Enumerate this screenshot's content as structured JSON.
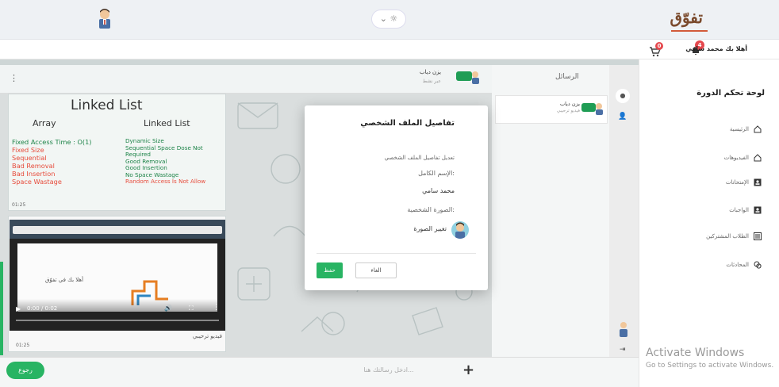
{
  "brand": {
    "name": "تفوّق"
  },
  "top": {
    "theme_toggle": "⌄ ☼"
  },
  "nav": {
    "user_name": "أهلا بك محمد سامي",
    "notifications_count": "4",
    "cart_count": "0"
  },
  "sidebar": {
    "title": "لوحة تحكم الدورة",
    "items": [
      {
        "label": "الرئيسية",
        "icon": "home-icon"
      },
      {
        "label": "الفيديوهات",
        "icon": "home-icon"
      },
      {
        "label": "الإمتحانات",
        "icon": "person-card-icon"
      },
      {
        "label": "الواجبات",
        "icon": "person-card-icon"
      },
      {
        "label": "الطلاب المشتركين",
        "icon": "list-icon"
      },
      {
        "label": "المحادثات",
        "icon": "chat-icon"
      }
    ]
  },
  "windows_watermark": {
    "line1": "Activate Windows",
    "line2": "Go to Settings to activate Windows."
  },
  "chat": {
    "header_name": "يزن دياب",
    "header_status": "عبر نشط",
    "list_title": "الرسائل",
    "list_items": [
      {
        "name": "يزن دياب",
        "preview": "فيديو ترحيبي"
      }
    ],
    "input_placeholder": "ادخل رسالتك هنا...",
    "back_label": "رجوع",
    "messages": [
      {
        "type": "slide",
        "title": "Linked List",
        "col_left": "Array",
        "col_right": "Linked List",
        "left_lines": [
          "Fixed Access Time : O(1)",
          "Fixed Size",
          "Sequential",
          "Bad Removal",
          "Bad Insertion",
          "Space Wastage"
        ],
        "right_lines": [
          "Dynamic Size",
          "Sequential Space Dose Not",
          "Required",
          "Good Removal",
          "Good Insertion",
          "No Space Wastage",
          "Random Access Is Not Allow"
        ],
        "time": "01:25"
      },
      {
        "type": "video",
        "video_caption": "أهلا بك في تفوّق",
        "player_time": "0:00 / 0:02",
        "caption": "فيديو ترحيبي",
        "time": "01:25"
      }
    ]
  },
  "modal": {
    "title": "تفاصيل الملف الشخصي",
    "edit_label": "تعديل تفاصيل الملف الشخصي",
    "fullname_label": "الإسم الكامل:",
    "fullname_value": "محمد سامي",
    "photo_label": "الصورة الشخصية:",
    "change_photo": "تغيير الصورة",
    "save_button": "حفظ",
    "cancel_button": "الغاء"
  },
  "colors": {
    "accent_green": "#28b463",
    "badge_red": "#e5484d",
    "brand_brown": "#7a4a2c"
  }
}
